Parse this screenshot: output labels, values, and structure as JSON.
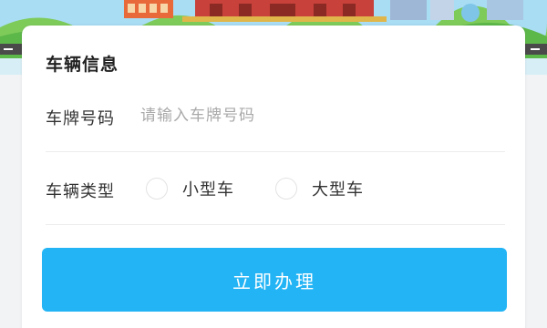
{
  "vehicle_info": {
    "title": "车辆信息",
    "plate": {
      "label": "车牌号码",
      "value": "",
      "placeholder": "请输入车牌号码"
    },
    "type": {
      "label": "车辆类型",
      "options": [
        "小型车",
        "大型车"
      ],
      "selected": null
    }
  },
  "actions": {
    "submit_label": "立即办理"
  },
  "colors": {
    "accent": "#22b4f5",
    "card": "#ffffff",
    "background": "#f1f3f5"
  }
}
